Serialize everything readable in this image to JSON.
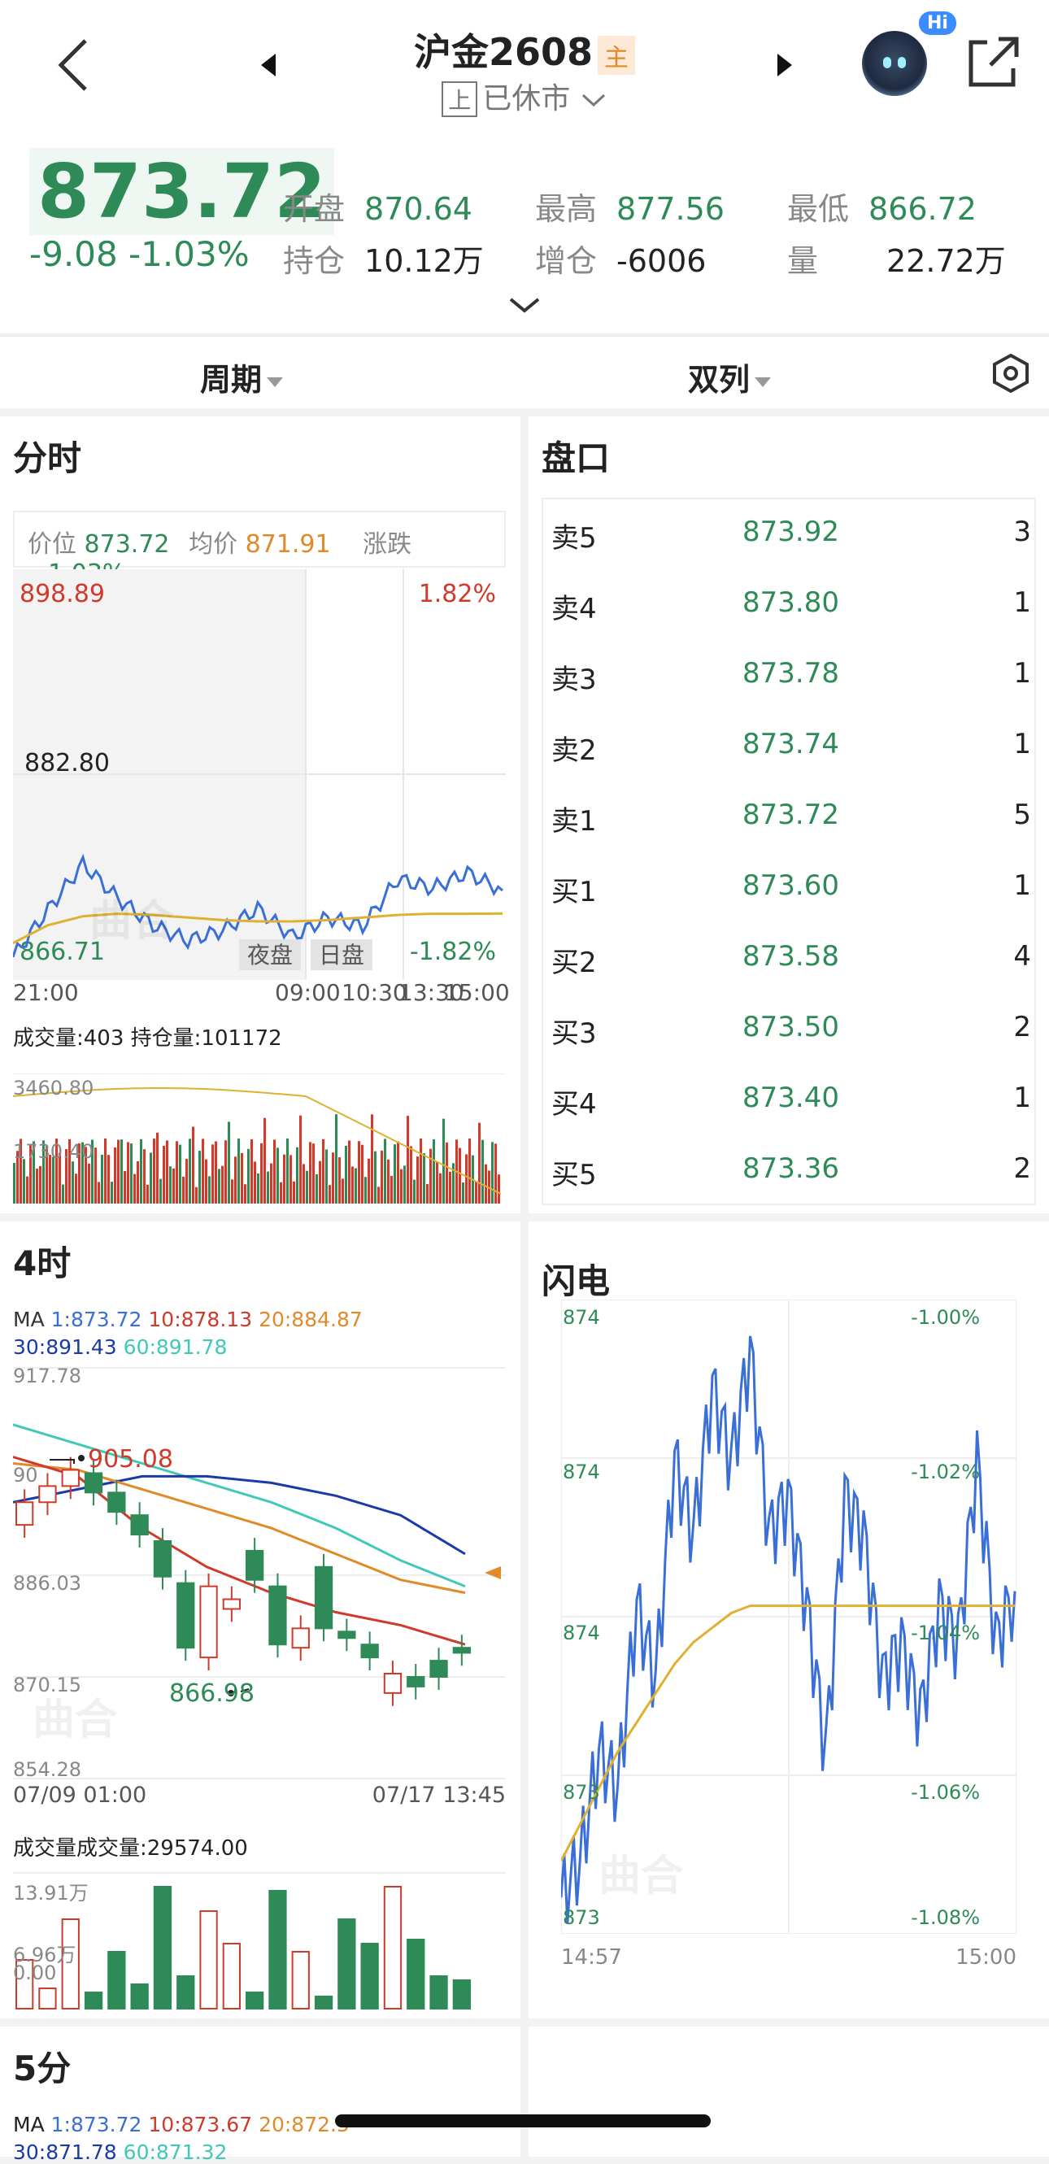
{
  "header": {
    "title": "沪金2608",
    "title_tag": "主",
    "status_box": "上",
    "status": "已休市",
    "hi_badge": "Hi"
  },
  "quote": {
    "last_price": "873.72",
    "change": "-9.08",
    "change_pct": "-1.03%",
    "stats": [
      {
        "key": "开盘",
        "value": "870.64"
      },
      {
        "key": "最高",
        "value": "877.56"
      },
      {
        "key": "最低",
        "value": "866.72"
      },
      {
        "key": "持仓",
        "value": "10.12万"
      },
      {
        "key": "增仓",
        "value": "-6006"
      },
      {
        "key": "量",
        "value": "22.72万"
      }
    ]
  },
  "tabs": {
    "period": "周期",
    "layout": "双列"
  },
  "intraday": {
    "title": "分时",
    "price_label": "价位",
    "price": "873.72",
    "avg_label": "均价",
    "avg": "871.91",
    "chg_label": "涨跌",
    "chg": "−1.03%",
    "y_top": "898.89",
    "y_mid": "882.80",
    "y_bot": "866.71",
    "pct_top": "1.82%",
    "pct_bot": "-1.82%",
    "night_label": "夜盘",
    "day_label": "日盘",
    "times": [
      "21:00",
      "09:00",
      "10:30",
      "13:30",
      "15:00"
    ],
    "vol_info": "成交量:403 持仓量:101172",
    "vol_top": "3460.80",
    "vol_mid": "1730.40"
  },
  "orderbook": {
    "title": "盘口",
    "rows": [
      {
        "label": "卖5",
        "price": "873.92",
        "qty": "3"
      },
      {
        "label": "卖4",
        "price": "873.80",
        "qty": "1"
      },
      {
        "label": "卖3",
        "price": "873.78",
        "qty": "1"
      },
      {
        "label": "卖2",
        "price": "873.74",
        "qty": "1"
      },
      {
        "label": "卖1",
        "price": "873.72",
        "qty": "5"
      },
      {
        "label": "买1",
        "price": "873.60",
        "qty": "1"
      },
      {
        "label": "买2",
        "price": "873.58",
        "qty": "4"
      },
      {
        "label": "买3",
        "price": "873.50",
        "qty": "2"
      },
      {
        "label": "买4",
        "price": "873.40",
        "qty": "1"
      },
      {
        "label": "买5",
        "price": "873.36",
        "qty": "2"
      }
    ]
  },
  "k4h": {
    "title": "4时",
    "ma_line1": {
      "prefix": "MA",
      "ma1": "1:873.72",
      "ma10": "10:878.13",
      "ma20": "20:884.87"
    },
    "ma_line2": {
      "ma30": "30:891.43",
      "ma60": "60:891.78"
    },
    "y_labels": [
      "917.78",
      "886.03",
      "870.15",
      "854.28"
    ],
    "y_partial": "90",
    "high_label": "905.08",
    "low_label": "866.98",
    "date_left": "07/09 01:00",
    "date_right": "07/17 13:45",
    "vol_info": "成交量成交量:29574.00",
    "vol_top": "13.91万",
    "vol_mid": "6.96万",
    "vol_bot": "0.00"
  },
  "flash": {
    "title": "闪电",
    "y_left": [
      "874",
      "874",
      "874",
      "873",
      "873"
    ],
    "y_right": [
      "-1.00%",
      "-1.02%",
      "-1.04%",
      "-1.06%",
      "-1.08%"
    ],
    "time_left": "14:57",
    "time_right": "15:00"
  },
  "k5m": {
    "title": "5分",
    "ma_line1": {
      "prefix": "MA",
      "ma1": "1:873.72",
      "ma10": "10:873.67",
      "ma20": "20:872.5"
    },
    "ma_line2": {
      "ma30": "30:871.78",
      "ma60": "60:871.32"
    }
  },
  "watermark": "曲合",
  "colors": {
    "up": "#d03a2a",
    "down": "#2e8b57",
    "line": "#3a6fd8",
    "avg": "#e0b030"
  },
  "chart_data": [
    {
      "type": "line",
      "title": "分时",
      "x": [
        "21:00",
        "09:00",
        "10:30",
        "13:30",
        "15:00"
      ],
      "ylim": [
        866.71,
        898.89
      ],
      "series": [
        {
          "name": "价位",
          "values": [
            868.5,
            872.2,
            875.8,
            873.1,
            871.0,
            869.8,
            870.6,
            872.3,
            870.1,
            871.6,
            870.9,
            874.6,
            873.9,
            875.1,
            873.72
          ]
        },
        {
          "name": "均价",
          "values": [
            869.6,
            871.0,
            871.7,
            871.9,
            871.8,
            871.6,
            871.4,
            871.3,
            871.3,
            871.4,
            871.6,
            871.8,
            871.9,
            871.9,
            871.91
          ]
        }
      ]
    },
    {
      "type": "bar",
      "title": "4时",
      "categories": [
        "07/09 01:00",
        "",
        "",
        "",
        "",
        "",
        "",
        "",
        "",
        "",
        "",
        "",
        "",
        "",
        "",
        "",
        "",
        "",
        "",
        "07/17 13:45"
      ],
      "ylim": [
        854.28,
        917.78
      ],
      "series": [
        {
          "name": "open",
          "values": [
            893.5,
            897.0,
            899.5,
            901.5,
            898.5,
            895.0,
            891.0,
            884.5,
            873.0,
            880.5,
            889.5,
            884.0,
            874.5,
            887.0,
            877.0,
            875.0,
            867.5,
            870.0,
            872.5,
            874.5
          ]
        },
        {
          "name": "close",
          "values": [
            897.0,
            899.5,
            902.0,
            898.5,
            895.5,
            892.0,
            885.5,
            874.5,
            884.0,
            882.0,
            885.0,
            875.0,
            877.5,
            877.5,
            876.0,
            873.0,
            870.5,
            868.5,
            870.0,
            873.72
          ]
        }
      ]
    },
    {
      "type": "line",
      "title": "闪电",
      "x": [
        "14:57",
        "15:00"
      ],
      "y_right": [
        "-1.00%",
        "-1.02%",
        "-1.04%",
        "-1.06%",
        "-1.08%"
      ],
      "series": [
        {
          "name": "价位",
          "values": [
            -1.08,
            -1.075,
            -1.06,
            -1.065,
            -1.04,
            -1.05,
            -1.02,
            -1.03,
            -1.01,
            -1.02,
            -1.005,
            -1.03,
            -1.025,
            -1.04,
            -1.06,
            -1.025,
            -1.03,
            -1.05,
            -1.045,
            -1.055,
            -1.04,
            -1.045,
            -1.02,
            -1.045,
            -1.038
          ]
        },
        {
          "name": "均价",
          "values": [
            -1.075,
            -1.07,
            -1.065,
            -1.06,
            -1.056,
            -1.052,
            -1.048,
            -1.045,
            -1.043,
            -1.041,
            -1.04,
            -1.04,
            -1.04,
            -1.04,
            -1.04,
            -1.04,
            -1.04,
            -1.04,
            -1.04,
            -1.04,
            -1.04,
            -1.04,
            -1.04,
            -1.04,
            -1.04
          ]
        }
      ]
    }
  ]
}
